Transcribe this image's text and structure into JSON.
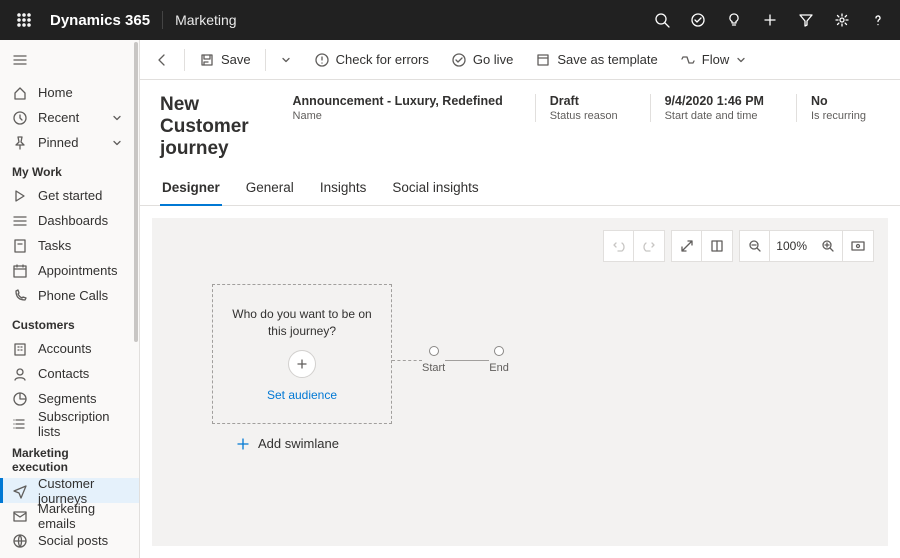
{
  "brand": "Dynamics 365",
  "app": "Marketing",
  "cmdbar": {
    "save": "Save",
    "check": "Check for errors",
    "golive": "Go live",
    "save_template": "Save as template",
    "flow": "Flow"
  },
  "record": {
    "title": "New Customer journey",
    "meta": [
      {
        "value": "Announcement - Luxury, Redefined",
        "label": "Name"
      },
      {
        "value": "Draft",
        "label": "Status reason"
      },
      {
        "value": "9/4/2020 1:46 PM",
        "label": "Start date and time"
      },
      {
        "value": "No",
        "label": "Is recurring"
      }
    ]
  },
  "tabs": [
    "Designer",
    "General",
    "Insights",
    "Social insights"
  ],
  "canvas": {
    "dropzone_question": "Who do you want to be on this journey?",
    "set_audience": "Set audience",
    "start": "Start",
    "end": "End",
    "add_swimlane": "Add swimlane",
    "zoom": "100%"
  },
  "sidebar": {
    "pinned": [
      "Home",
      "Recent",
      "Pinned"
    ],
    "my_work_header": "My Work",
    "my_work": [
      "Get started",
      "Dashboards",
      "Tasks",
      "Appointments",
      "Phone Calls"
    ],
    "customers_header": "Customers",
    "customers": [
      "Accounts",
      "Contacts",
      "Segments",
      "Subscription lists"
    ],
    "marketing_header": "Marketing execution",
    "marketing": [
      "Customer journeys",
      "Marketing emails",
      "Social posts"
    ]
  }
}
